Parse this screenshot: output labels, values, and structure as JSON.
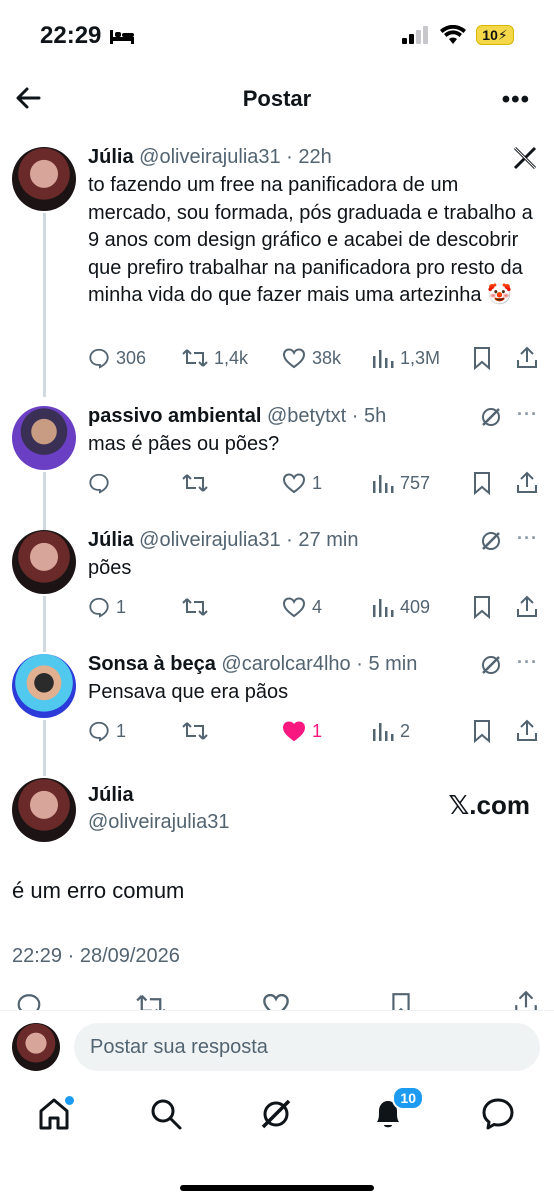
{
  "status_bar": {
    "time": "22:29",
    "battery": "10"
  },
  "header": {
    "title": "Postar"
  },
  "tweets": [
    {
      "name": "Júlia",
      "handle": "@oliveirajulia31",
      "time": "22h",
      "text": "to fazendo um free na panificadora de um mercado, sou formada, pós graduada e trabalho a 9 anos com design gráfico e acabei de descobrir que prefiro trabalhar na panificadora pro resto da minha vida do que fazer mais uma artezinha 🤡",
      "replies": "306",
      "retweets": "1,4k",
      "likes": "38k",
      "views": "1,3M"
    },
    {
      "name": "passivo ambiental",
      "handle": "@betytxt",
      "time": "5h",
      "text": "mas é pães ou pões?",
      "replies": "",
      "retweets": "",
      "likes": "1",
      "views": "757"
    },
    {
      "name": "Júlia",
      "handle": "@oliveirajulia31",
      "time": "27 min",
      "text": "pões",
      "replies": "1",
      "retweets": "",
      "likes": "4",
      "views": "409"
    },
    {
      "name": "Sonsa à beça",
      "handle": "@carolcar4lho",
      "time": "5 min",
      "text": "Pensava que era pãos",
      "replies": "1",
      "retweets": "",
      "likes": "1",
      "views": "2"
    }
  ],
  "final": {
    "name": "Júlia",
    "handle": "@oliveirajulia31",
    "brand": "𝕏.com",
    "text": "é um erro comum",
    "timestamp": "22:29 · 28/09/2026"
  },
  "reply_bar": {
    "placeholder": "Postar sua resposta"
  },
  "tabbar": {
    "notif_count": "10"
  },
  "colors": {
    "accent": "#1d9bf0",
    "like": "#f91880",
    "muted": "#536471"
  }
}
